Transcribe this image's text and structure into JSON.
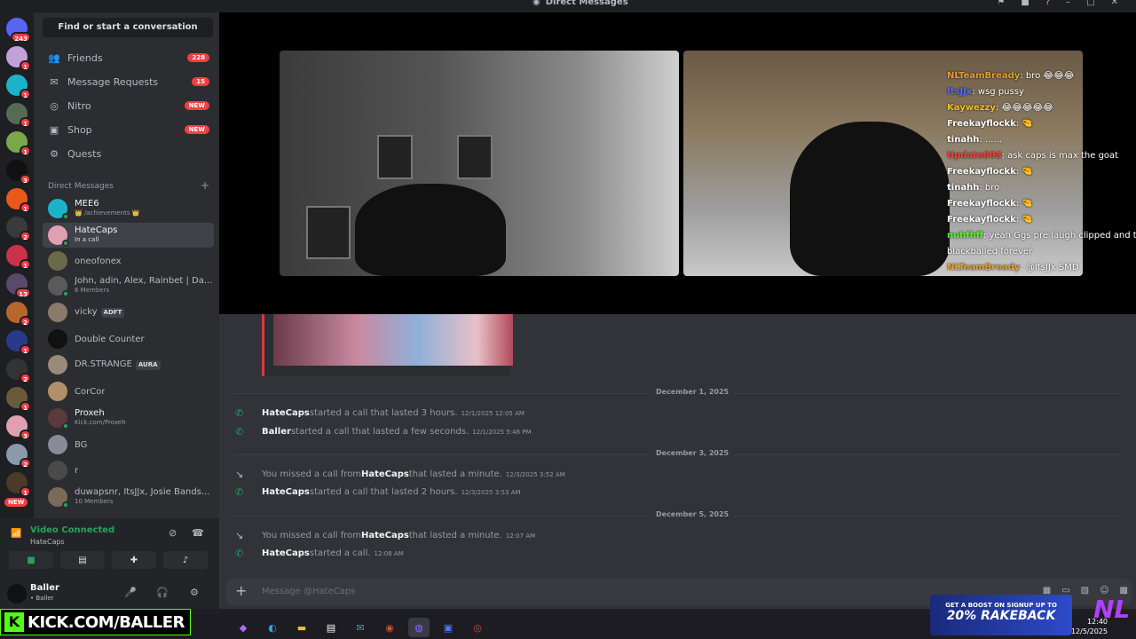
{
  "window": {
    "title": "Direct Messages"
  },
  "rail": {
    "top_badge": "243",
    "badges": [
      "1",
      "1",
      "1",
      "1",
      "1",
      "3",
      "2",
      "1",
      "2",
      "1",
      "13",
      "2",
      "1",
      "3",
      "2",
      "1"
    ],
    "new_label": "NEW"
  },
  "sidebar": {
    "search": "Find or start a conversation",
    "nav": [
      {
        "label": "Friends",
        "badge": "228"
      },
      {
        "label": "Message Requests",
        "badge": "15"
      },
      {
        "label": "Nitro",
        "badge": "NEW"
      },
      {
        "label": "Shop",
        "badge": "NEW"
      },
      {
        "label": "Quests",
        "badge": ""
      }
    ],
    "dm_header": "Direct Messages",
    "dms": [
      {
        "name": "MEE6",
        "sub": "👑 /achievements 👑"
      },
      {
        "name": "HateCaps",
        "sub": "In a call"
      },
      {
        "name": "oneofonex",
        "sub": ""
      },
      {
        "name": "John, adin, Alex, Rainbet | Da...",
        "sub": "6 Members"
      },
      {
        "name": "vicky",
        "sub": "",
        "tag": "ADFT"
      },
      {
        "name": "Double Counter",
        "sub": ""
      },
      {
        "name": "DR.STRANGE",
        "sub": "",
        "tag": "AURA"
      },
      {
        "name": "CorCor",
        "sub": ""
      },
      {
        "name": "Proxeh",
        "sub": "Kick.com/Proxeh"
      },
      {
        "name": "BG",
        "sub": ""
      },
      {
        "name": "r",
        "sub": ""
      },
      {
        "name": "duwapsnr, ItsJJx, Josie Bands...",
        "sub": "10 Members"
      }
    ]
  },
  "voice": {
    "status": "Video Connected",
    "channel": "HateCaps"
  },
  "user": {
    "name": "Baller",
    "status": "• Baller"
  },
  "overlay_chat": [
    {
      "user": "NLTeamBready",
      "text": ": bro 😂😂😂",
      "color": "#e0a030"
    },
    {
      "user": "ItsJJx",
      "text": ": wsg pussy",
      "color": "#4a6cff"
    },
    {
      "user": "Kaywezzy",
      "text": ": 😂😂😂😂😂",
      "color": "#f0c020"
    },
    {
      "user": "Freekayflockk",
      "text": ": 🤏",
      "color": "#ffffff"
    },
    {
      "user": "tinahh",
      "text": ": ......",
      "color": "#ffffff"
    },
    {
      "user": "Update808",
      "text": ": ask caps is max the goat",
      "color": "#ff3b3b"
    },
    {
      "user": "Freekayflockk",
      "text": ": 🤏",
      "color": "#ffffff"
    },
    {
      "user": "tinahh",
      "text": ": bro",
      "color": "#ffffff"
    },
    {
      "user": "Freekayflockk",
      "text": ": 🤏",
      "color": "#ffffff"
    },
    {
      "user": "Freekayflockk",
      "text": ": 🤏",
      "color": "#ffffff"
    },
    {
      "user": "nuhfhff",
      "text": ": yeah Ggs pre laugh clipped and then",
      "color": "#53fc18"
    },
    {
      "user": "",
      "text": "blackballed forever",
      "color": "#ffffff"
    },
    {
      "user": "NLTeamBready",
      "text": ": @ItsJJx SMD",
      "color": "#e0a030"
    }
  ],
  "messages": {
    "dates": [
      "December 1, 2025",
      "December 3, 2025",
      "December 5, 2025"
    ],
    "items": [
      {
        "who": "HateCaps",
        "pre": "",
        "text": " started a call that lasted 3 hours.",
        "ts": "12/1/2025 12:05 AM",
        "missed": false
      },
      {
        "who": "Baller",
        "pre": "",
        "text": " started a call that lasted a few seconds.",
        "ts": "12/1/2025 5:48 PM",
        "missed": false
      },
      {
        "who": "HateCaps",
        "pre": "You missed a call from ",
        "text": " that lasted a minute.",
        "ts": "12/3/2025 3:52 AM",
        "missed": true
      },
      {
        "who": "HateCaps",
        "pre": "",
        "text": " started a call that lasted 2 hours.",
        "ts": "12/3/2025 3:53 AM",
        "missed": false
      },
      {
        "who": "HateCaps",
        "pre": "You missed a call from ",
        "text": " that lasted a minute.",
        "ts": "12:07 AM",
        "missed": true
      },
      {
        "who": "HateCaps",
        "pre": "",
        "text": " started a call.",
        "ts": "12:08 AM",
        "missed": false
      }
    ]
  },
  "composer": {
    "placeholder": "Message @HateCaps"
  },
  "taskbar": {
    "time": "12:40",
    "date": "12/5/2025"
  },
  "overlays": {
    "kick": "KICK.COM/BALLER",
    "promo_line1": "GET A BOOST ON SIGNUP UP TO",
    "promo_line2": "20% RAKEBACK",
    "nl_logo": "NL"
  }
}
